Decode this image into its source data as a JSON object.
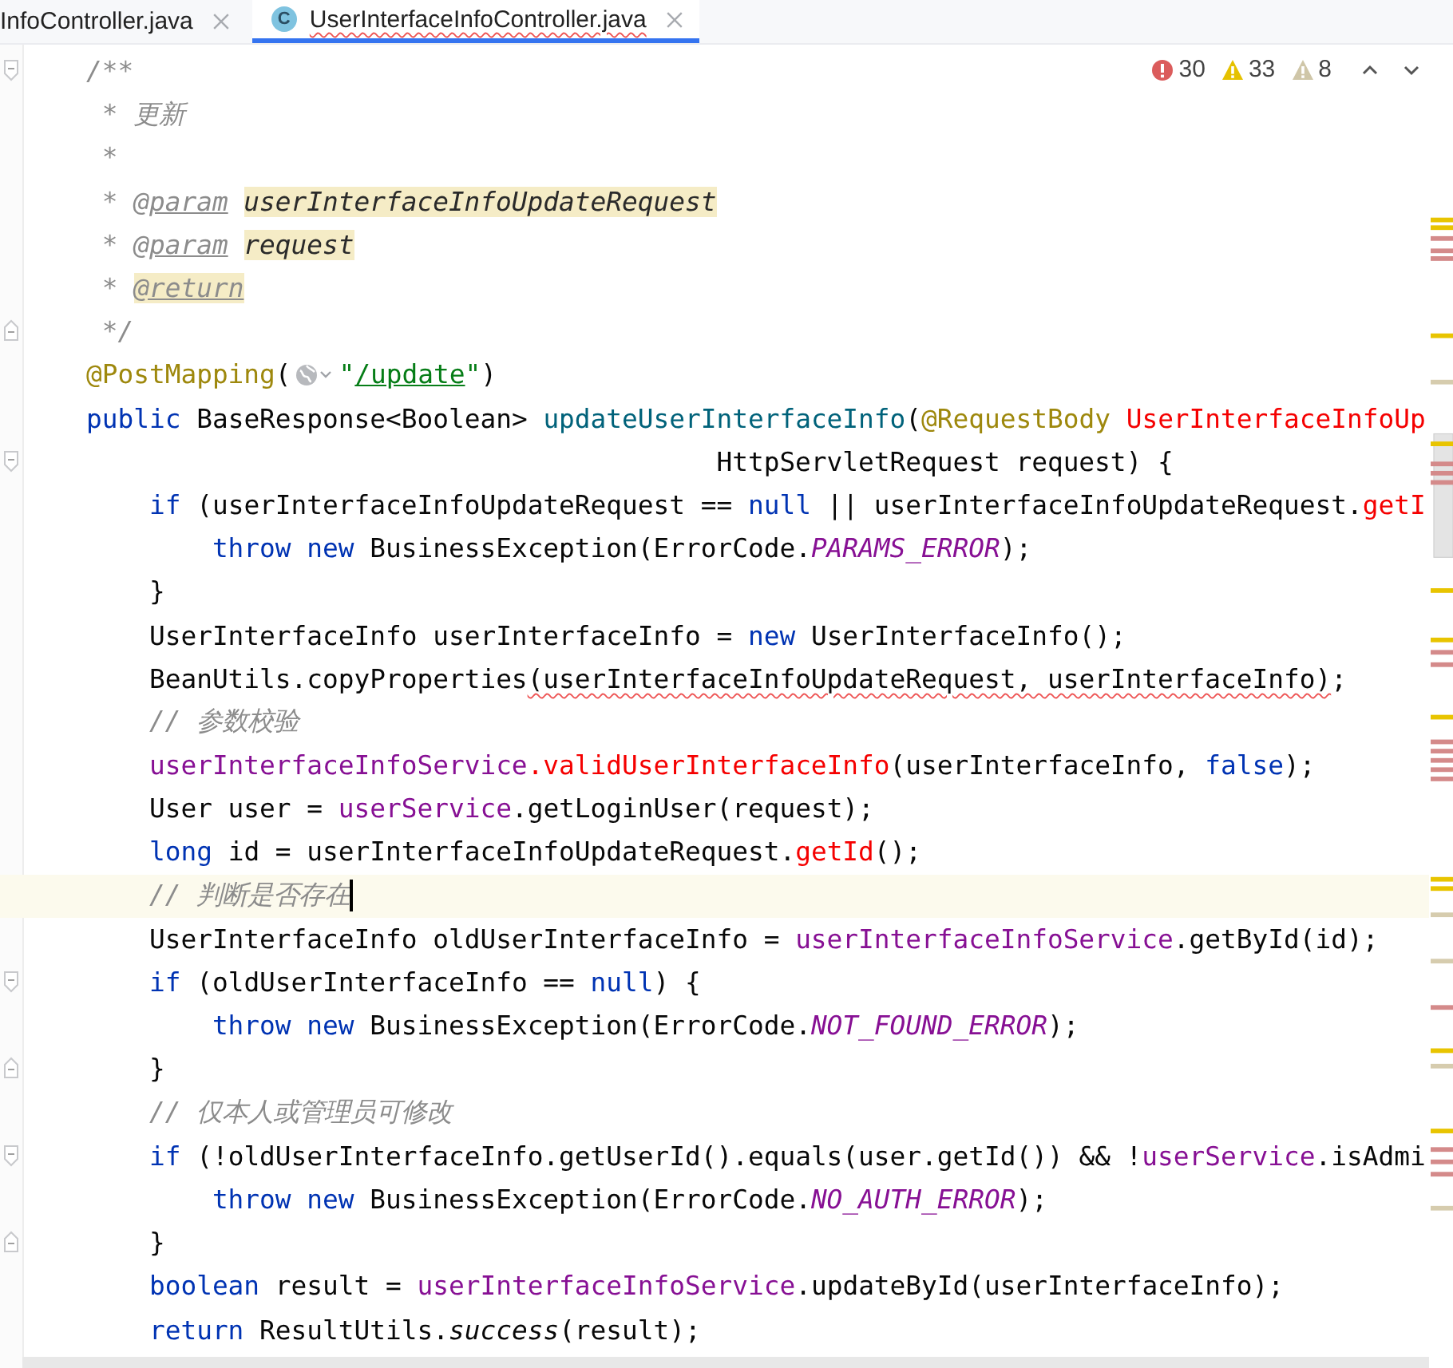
{
  "tabs": [
    {
      "label": "InfoController.java",
      "selected": false,
      "errors": false
    },
    {
      "label": "UserInterfaceInfoController.java",
      "selected": true,
      "errors": true,
      "icon_letter": "C"
    }
  ],
  "inspections": [
    {
      "kind": "error",
      "count": "30"
    },
    {
      "kind": "warning",
      "count": "33"
    },
    {
      "kind": "weak",
      "count": "8"
    }
  ],
  "lines": [
    {
      "fold_start": true,
      "fold_end": false,
      "current": false,
      "tokens": [
        {
          "text": "/**",
          "kind": "doc"
        }
      ]
    },
    {
      "fold_start": false,
      "fold_end": false,
      "current": false,
      "tokens": [
        {
          "text": " * 更新",
          "kind": "doc"
        }
      ]
    },
    {
      "fold_start": false,
      "fold_end": false,
      "current": false,
      "tokens": [
        {
          "text": " *",
          "kind": "doc"
        }
      ]
    },
    {
      "fold_start": false,
      "fold_end": false,
      "current": false,
      "tokens": [
        {
          "text": " * ",
          "kind": "doc"
        },
        {
          "text": "@param",
          "kind": "doc-tag"
        },
        {
          "text": "userInterfaceInfoUpdateRequest",
          "kind": "doc-param"
        }
      ]
    },
    {
      "fold_start": false,
      "fold_end": false,
      "current": false,
      "tokens": [
        {
          "text": " * ",
          "kind": "doc"
        },
        {
          "text": "@param",
          "kind": "doc-tag"
        },
        {
          "text": "request",
          "kind": "doc-param"
        }
      ]
    },
    {
      "fold_start": false,
      "fold_end": false,
      "current": false,
      "tokens": [
        {
          "text": " * ",
          "kind": "doc"
        },
        {
          "text": "@return",
          "kind": "doc-tag-hl"
        }
      ]
    },
    {
      "fold_start": false,
      "fold_end": true,
      "current": false,
      "tokens": [
        {
          "text": " */",
          "kind": "doc"
        }
      ]
    },
    {
      "fold_start": false,
      "fold_end": false,
      "current": false,
      "tokens": [
        {
          "text": "@PostMapping",
          "kind": "annotation"
        },
        {
          "text": "(",
          "kind": "plain"
        },
        {
          "kind": "inlay"
        },
        {
          "text": "\"",
          "kind": "string"
        },
        {
          "text": "/update",
          "kind": "link-string"
        },
        {
          "text": "\"",
          "kind": "string"
        },
        {
          "text": ")",
          "kind": "plain"
        }
      ]
    },
    {
      "fold_start": false,
      "fold_end": false,
      "current": false,
      "tokens": [
        {
          "text": "public",
          "kind": "keyword"
        },
        {
          "text": " BaseResponse<Boolean> ",
          "kind": "plain"
        },
        {
          "text": "updateUserInterfaceInfo",
          "kind": "method"
        },
        {
          "text": "(",
          "kind": "plain"
        },
        {
          "text": "@RequestBody ",
          "kind": "annotation"
        },
        {
          "text": "UserInterfaceInfoUp",
          "kind": "error"
        }
      ]
    },
    {
      "fold_start": true,
      "fold_end": false,
      "current": false,
      "tokens": [
        {
          "text": "                                        HttpServletRequest request) {",
          "kind": "plain"
        }
      ]
    },
    {
      "fold_start": false,
      "fold_end": false,
      "current": false,
      "tokens": [
        {
          "text": "    if",
          "kind": "keyword"
        },
        {
          "text": " (userInterfaceInfoUpdateRequest == ",
          "kind": "plain"
        },
        {
          "text": "null",
          "kind": "keyword"
        },
        {
          "text": " || userInterfaceInfoUpdateRequest.",
          "kind": "plain"
        },
        {
          "text": "getI",
          "kind": "error"
        }
      ]
    },
    {
      "fold_start": false,
      "fold_end": false,
      "current": false,
      "tokens": [
        {
          "text": "        throw new",
          "kind": "keyword"
        },
        {
          "text": " BusinessException(ErrorCode.",
          "kind": "plain"
        },
        {
          "text": "PARAMS_ERROR",
          "kind": "constant"
        },
        {
          "text": ");",
          "kind": "plain"
        }
      ]
    },
    {
      "fold_start": false,
      "fold_end": false,
      "current": false,
      "tokens": [
        {
          "text": "    }",
          "kind": "plain"
        }
      ]
    },
    {
      "fold_start": false,
      "fold_end": false,
      "current": false,
      "tokens": [
        {
          "text": "    UserInterfaceInfo userInterfaceInfo = ",
          "kind": "plain"
        },
        {
          "text": "new",
          "kind": "keyword"
        },
        {
          "text": " UserInterfaceInfo();",
          "kind": "plain"
        }
      ]
    },
    {
      "fold_start": false,
      "fold_end": false,
      "current": false,
      "tokens": [
        {
          "text": "    BeanUtils.copyProperties",
          "kind": "plain"
        },
        {
          "text": "(userInterfaceInfoUpdateRequest, userInterfaceInfo)",
          "kind": "squiggle"
        },
        {
          "text": ";",
          "kind": "plain"
        }
      ]
    },
    {
      "fold_start": false,
      "fold_end": false,
      "current": false,
      "tokens": [
        {
          "text": "    // 参数校验",
          "kind": "comment"
        }
      ]
    },
    {
      "fold_start": false,
      "fold_end": false,
      "current": false,
      "tokens": [
        {
          "text": "    userInterfaceInfoService",
          "kind": "field"
        },
        {
          "text": ".validUserInterfaceInfo",
          "kind": "error"
        },
        {
          "text": "(userInterfaceInfo, ",
          "kind": "plain"
        },
        {
          "text": "false",
          "kind": "keyword"
        },
        {
          "text": ");",
          "kind": "plain"
        }
      ]
    },
    {
      "fold_start": false,
      "fold_end": false,
      "current": false,
      "tokens": [
        {
          "text": "    User user = ",
          "kind": "plain"
        },
        {
          "text": "userService",
          "kind": "field"
        },
        {
          "text": ".getLoginUser(request);",
          "kind": "plain"
        }
      ]
    },
    {
      "fold_start": false,
      "fold_end": false,
      "current": false,
      "tokens": [
        {
          "text": "    long",
          "kind": "keyword"
        },
        {
          "text": " id = userInterfaceInfoUpdateRequest.",
          "kind": "plain"
        },
        {
          "text": "getId",
          "kind": "error"
        },
        {
          "text": "();",
          "kind": "plain"
        }
      ]
    },
    {
      "fold_start": false,
      "fold_end": false,
      "current": true,
      "tokens": [
        {
          "text": "    // 判断是否存在",
          "kind": "comment"
        }
      ]
    },
    {
      "fold_start": false,
      "fold_end": false,
      "current": false,
      "tokens": [
        {
          "text": "    UserInterfaceInfo oldUserInterfaceInfo = ",
          "kind": "plain"
        },
        {
          "text": "userInterfaceInfoService",
          "kind": "field"
        },
        {
          "text": ".getById(id);",
          "kind": "plain"
        }
      ]
    },
    {
      "fold_start": true,
      "fold_end": false,
      "current": false,
      "tokens": [
        {
          "text": "    if",
          "kind": "keyword"
        },
        {
          "text": " (oldUserInterfaceInfo == ",
          "kind": "plain"
        },
        {
          "text": "null",
          "kind": "keyword"
        },
        {
          "text": ") {",
          "kind": "plain"
        }
      ]
    },
    {
      "fold_start": false,
      "fold_end": false,
      "current": false,
      "tokens": [
        {
          "text": "        throw new",
          "kind": "keyword"
        },
        {
          "text": " BusinessException(ErrorCode.",
          "kind": "plain"
        },
        {
          "text": "NOT_FOUND_ERROR",
          "kind": "constant"
        },
        {
          "text": ");",
          "kind": "plain"
        }
      ]
    },
    {
      "fold_start": false,
      "fold_end": true,
      "current": false,
      "tokens": [
        {
          "text": "    }",
          "kind": "plain"
        }
      ]
    },
    {
      "fold_start": false,
      "fold_end": false,
      "current": false,
      "tokens": [
        {
          "text": "    // 仅本人或管理员可修改",
          "kind": "comment"
        }
      ]
    },
    {
      "fold_start": true,
      "fold_end": false,
      "current": false,
      "tokens": [
        {
          "text": "    if",
          "kind": "keyword"
        },
        {
          "text": " (!oldUserInterfaceInfo.getUserId().equals(user.getId()) && !",
          "kind": "plain"
        },
        {
          "text": "userService",
          "kind": "field"
        },
        {
          "text": ".isAdmi",
          "kind": "plain"
        }
      ]
    },
    {
      "fold_start": false,
      "fold_end": false,
      "current": false,
      "tokens": [
        {
          "text": "        throw new",
          "kind": "keyword"
        },
        {
          "text": " BusinessException(ErrorCode.",
          "kind": "plain"
        },
        {
          "text": "NO_AUTH_ERROR",
          "kind": "constant"
        },
        {
          "text": ");",
          "kind": "plain"
        }
      ]
    },
    {
      "fold_start": false,
      "fold_end": true,
      "current": false,
      "tokens": [
        {
          "text": "    }",
          "kind": "plain"
        }
      ]
    },
    {
      "fold_start": false,
      "fold_end": false,
      "current": false,
      "tokens": [
        {
          "text": "    boolean",
          "kind": "keyword"
        },
        {
          "text": " result = ",
          "kind": "plain"
        },
        {
          "text": "userInterfaceInfoService",
          "kind": "field"
        },
        {
          "text": ".updateById(userInterfaceInfo);",
          "kind": "plain"
        }
      ]
    },
    {
      "fold_start": false,
      "fold_end": false,
      "current": false,
      "tokens": [
        {
          "text": "    return",
          "kind": "keyword"
        },
        {
          "text": " ResultUtils.",
          "kind": "plain"
        },
        {
          "text": "success",
          "kind": "italic"
        },
        {
          "text": "(result);",
          "kind": "plain"
        }
      ]
    }
  ]
}
